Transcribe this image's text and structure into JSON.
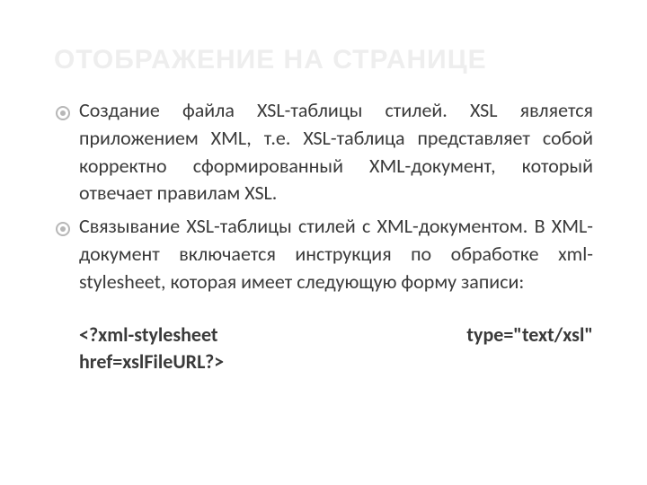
{
  "title": "ОТОБРАЖЕНИЕ НА СТРАНИЦЕ",
  "bullets": [
    "Создание файла XSL-таблицы стилей. XSL является приложением XML, т.е. XSL-таблица представляет собой корректно сформированный XML-документ, который отвечает правилам XSL.",
    "Связывание XSL-таблицы стилей с XML-документом. В XML-документ включается инструкция по обработке xml-stylesheet, которая имеет следующую форму записи:"
  ],
  "code": {
    "line1": "<?xml-stylesheet type=\"text/xsl\"",
    "line2": "href=xslFileURL?>"
  }
}
